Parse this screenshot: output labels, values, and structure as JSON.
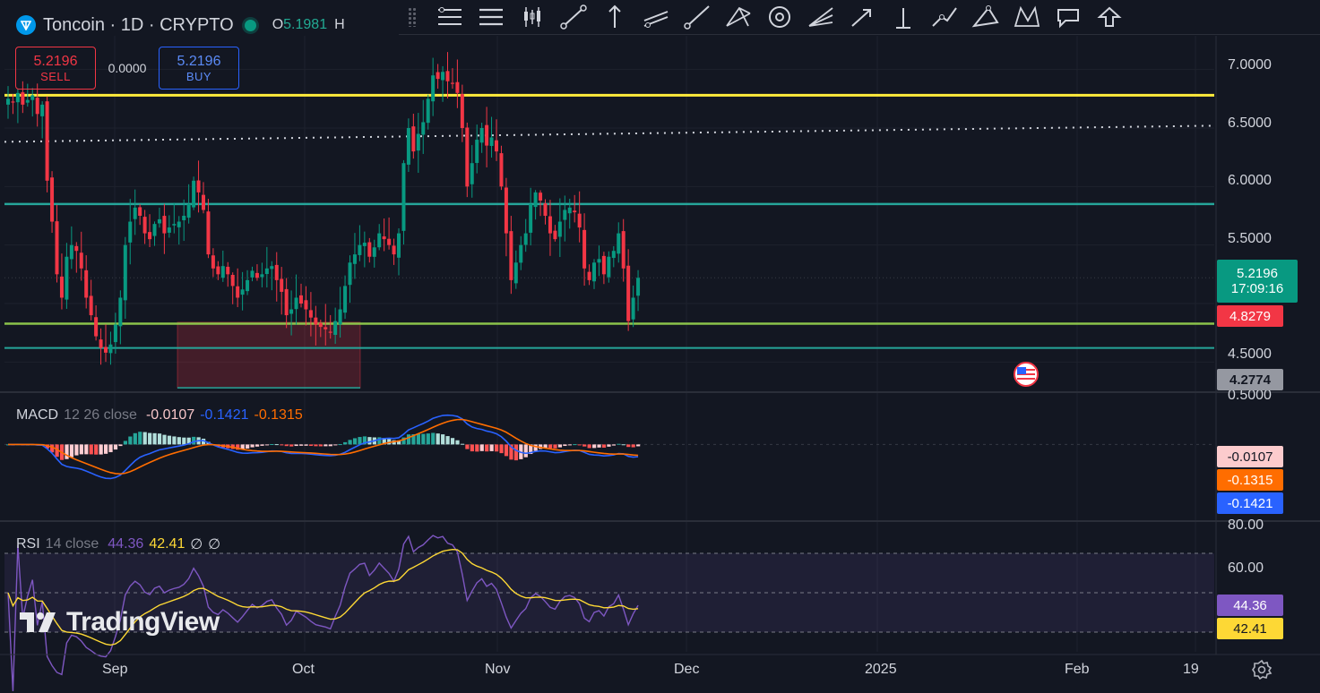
{
  "header": {
    "symbol": "Toncoin",
    "interval": "1D",
    "market": "CRYPTO",
    "open_label": "O",
    "open_value": "5.1981",
    "high_label": "H"
  },
  "toolbar": {
    "tools": [
      "fib-retracement-icon",
      "horizontal-lines-icon",
      "candles-icon",
      "trend-line-icon",
      "vertical-line-icon",
      "parallel-channel-icon",
      "ray-icon",
      "pitchfork-icon",
      "target-icon",
      "pitchfan-icon",
      "arrow-line-icon",
      "info-line-icon",
      "path-icon",
      "triangle-icon",
      "xabcd-icon",
      "callout-icon",
      "arrow-up-icon"
    ]
  },
  "trade": {
    "sell_price": "5.2196",
    "sell_label": "SELL",
    "spread": "0.0000",
    "buy_price": "5.2196",
    "buy_label": "BUY"
  },
  "price_axis": {
    "ticks": [
      "7.0000",
      "6.5000",
      "6.0000",
      "5.5000",
      "4.5000"
    ],
    "current_price": "5.2196",
    "countdown": "17:09:16",
    "support_label": "4.8279",
    "crosshair_label": "4.2774",
    "clipped_tick": "0.5000"
  },
  "macd": {
    "name": "MACD",
    "params": "12 26 close",
    "hist": "-0.0107",
    "macd": "-0.1421",
    "signal": "-0.1315",
    "clipped_tick": "0.5000",
    "axis_hist": "-0.0107",
    "axis_signal": "-0.1315",
    "axis_macd": "-0.1421"
  },
  "rsi": {
    "name": "RSI",
    "params": "14 close",
    "rsi": "44.36",
    "ma": "42.41",
    "extra1": "∅",
    "extra2": "∅",
    "tick_80": "80.00",
    "tick_60": "60.00",
    "axis_rsi": "44.36",
    "axis_ma": "42.41"
  },
  "time_axis": [
    "Sep",
    "Oct",
    "Nov",
    "Dec",
    "2025",
    "Feb",
    "19"
  ],
  "branding": {
    "logo_text": "TradingView"
  },
  "colors": {
    "background": "#131722",
    "up": "#089981",
    "down": "#f23645",
    "resistance": "#ffeb3b",
    "level_teal": "#26a69a",
    "support_green": "#8bc34a",
    "macd_line": "#2962ff",
    "signal_line": "#ff6d00",
    "rsi_line": "#7e57c2",
    "rsi_ma": "#fdd835"
  },
  "chart_data": {
    "type": "candlestick",
    "symbol": "Toncoin",
    "interval": "1D",
    "y_range": [
      4.25,
      7.25
    ],
    "last_candles": [
      {
        "o": 5.0,
        "h": 5.32,
        "l": 4.85,
        "c": 5.2196
      }
    ],
    "series": [
      {
        "name": "Toncoin close (approx)",
        "values": [
          6.75,
          6.72,
          6.8,
          6.7,
          6.74,
          6.78,
          6.62,
          6.7,
          6.05,
          5.7,
          5.25,
          5.05,
          5.4,
          5.5,
          5.45,
          5.3,
          5.05,
          4.9,
          4.72,
          4.62,
          4.58,
          4.65,
          4.82,
          5.05,
          5.5,
          5.7,
          5.82,
          5.75,
          5.6,
          5.55,
          5.68,
          5.72,
          5.6,
          5.65,
          5.68,
          5.7,
          5.75,
          5.85,
          6.05,
          5.95,
          5.8,
          5.42,
          5.3,
          5.25,
          5.32,
          5.25,
          5.15,
          5.05,
          5.12,
          5.2,
          5.28,
          5.22,
          5.25,
          5.3,
          5.32,
          5.2,
          5.1,
          4.9,
          4.95,
          5.05,
          5.0,
          4.95,
          4.88,
          4.82,
          4.8,
          4.78,
          4.75,
          4.85,
          4.95,
          5.15,
          5.35,
          5.42,
          5.5,
          5.52,
          5.4,
          5.48,
          5.6,
          5.55,
          5.5,
          5.42,
          5.6,
          6.2,
          6.5,
          6.3,
          6.45,
          6.55,
          6.75,
          6.95,
          6.92,
          6.98,
          6.9,
          6.88,
          6.8,
          6.5,
          6.0,
          6.2,
          6.4,
          6.5,
          6.35,
          6.42,
          6.3,
          6.0,
          5.6,
          5.2,
          5.35,
          5.5,
          5.6,
          5.85,
          5.95,
          5.88,
          5.75,
          5.6,
          5.55,
          5.7,
          5.8,
          5.82,
          5.78,
          5.65,
          5.3,
          5.2,
          5.35,
          5.38,
          5.25,
          5.4,
          5.45,
          5.6,
          5.3,
          4.85,
          5.05,
          5.2196
        ]
      }
    ],
    "levels": [
      {
        "name": "resistance",
        "value": 6.78
      },
      {
        "name": "dotted",
        "value": 6.52
      },
      {
        "name": "teal-upper",
        "value": 5.85
      },
      {
        "name": "support-green",
        "value": 4.8279
      },
      {
        "name": "teal-lower",
        "value": 4.62
      }
    ],
    "macd_y_range": [
      -0.75,
      0.5
    ],
    "rsi_y_range": [
      20,
      85
    ],
    "x_ticks": [
      "Sep",
      "Oct",
      "Nov",
      "Dec",
      "2025",
      "Feb",
      "19"
    ]
  }
}
